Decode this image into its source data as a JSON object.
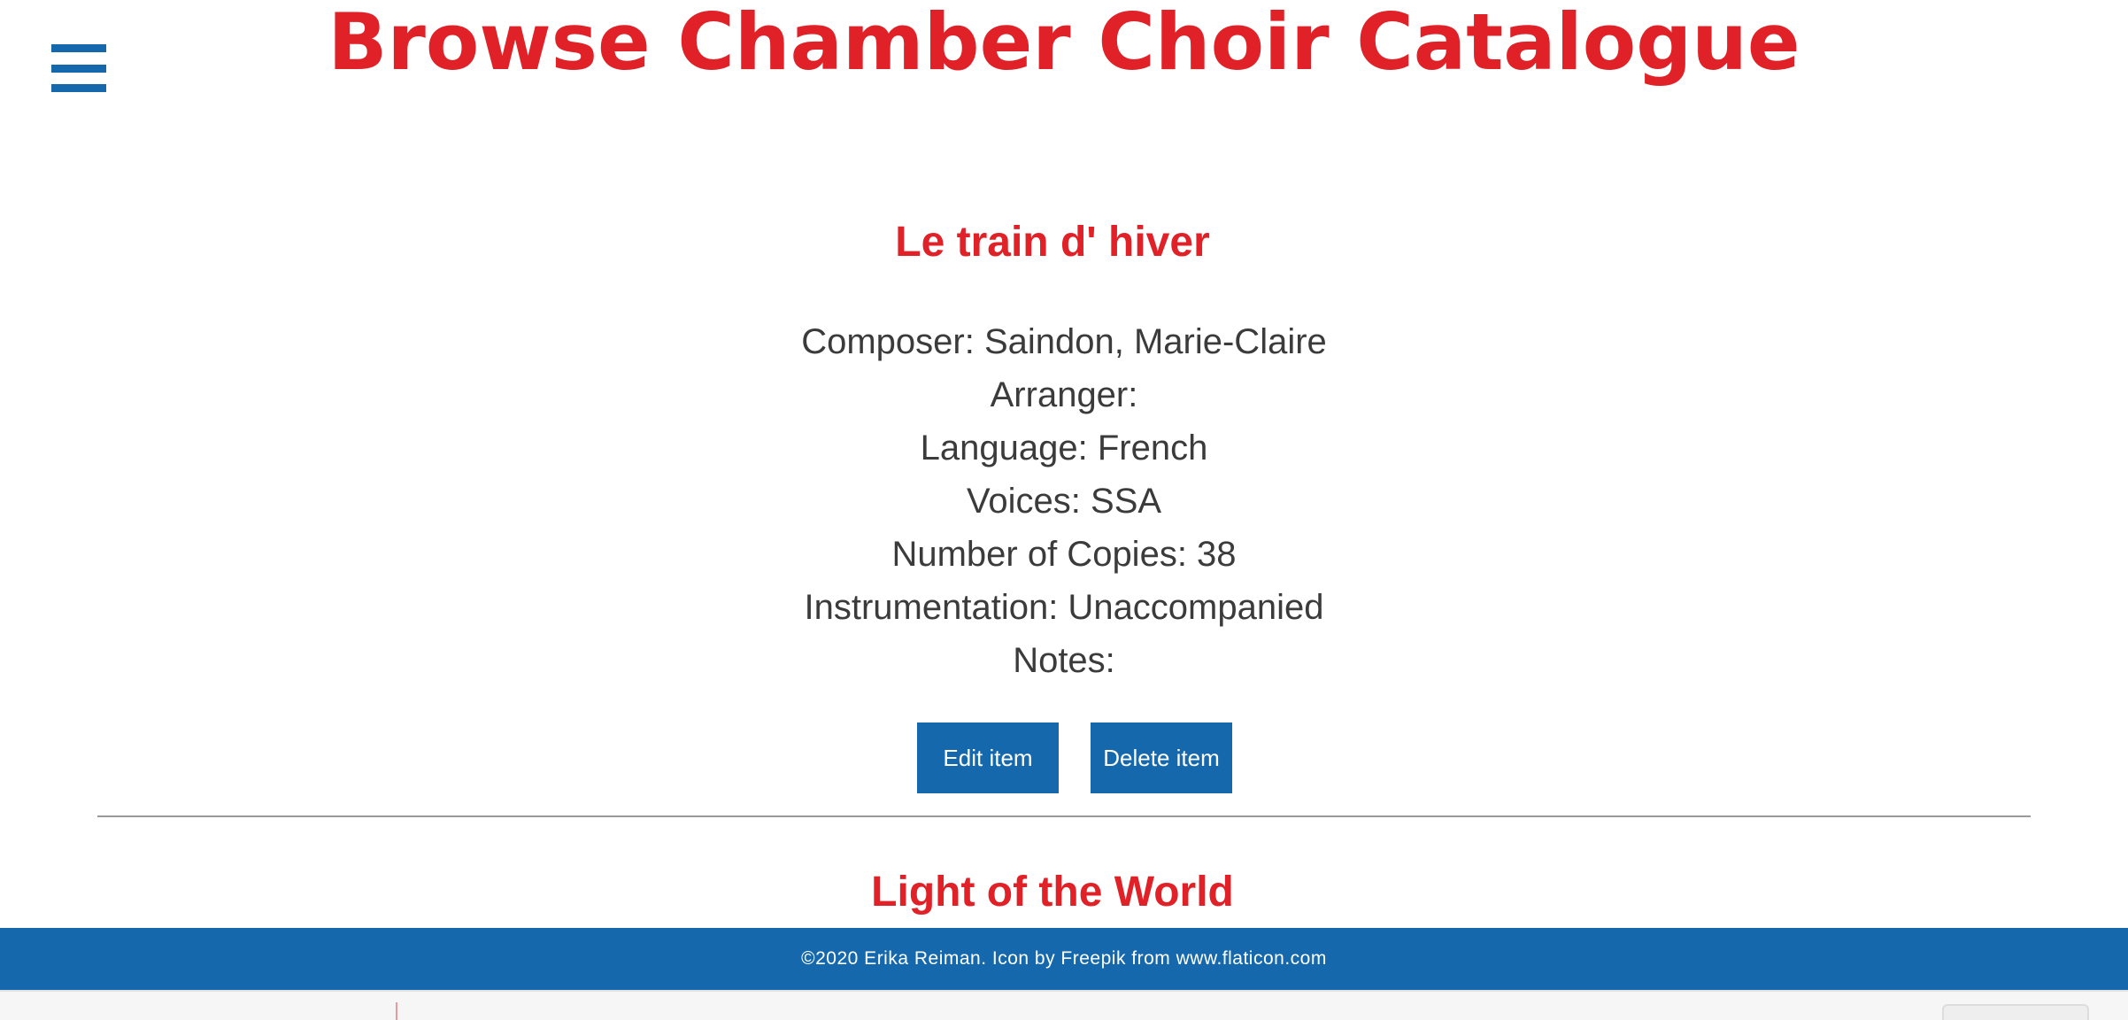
{
  "header": {
    "title": "Browse Chamber Choir Catalogue",
    "menu_icon": "hamburger-menu-icon"
  },
  "items": [
    {
      "title": "Le train d' hiver",
      "details": [
        "Composer: Saindon, Marie-Claire",
        "Arranger:",
        "Language: French",
        "Voices: SSA",
        "Number of Copies: 38",
        "Instrumentation: Unaccompanied",
        "Notes:"
      ],
      "edit_label": "Edit item",
      "delete_label": "Delete item"
    },
    {
      "title": "Light of the World"
    }
  ],
  "footer": {
    "text": "©2020 Erika Reiman. Icon by Freepik from www.flaticon.com"
  },
  "colors": {
    "accent_red": "#e02228",
    "brand_blue": "#1668ad",
    "body_text": "#3b3b3b"
  }
}
